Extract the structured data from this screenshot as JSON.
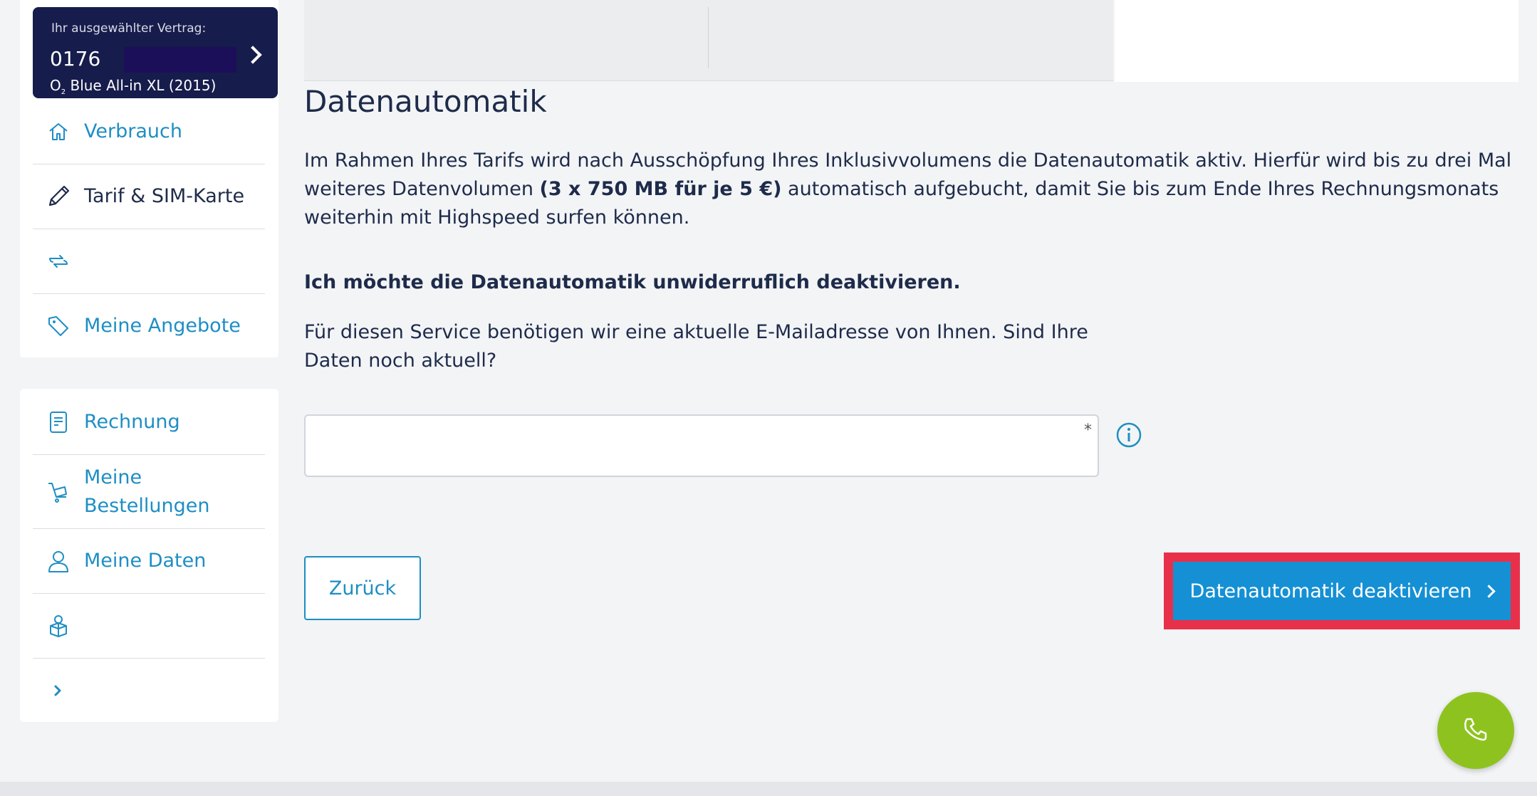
{
  "sidebar": {
    "contract": {
      "label": "Ihr ausgewählter Vertrag:",
      "number": "0176",
      "plan_prefix": "O",
      "plan_sub": "2",
      "plan_name": " Blue All-in XL (2015)"
    },
    "items": [
      {
        "label": "Verbrauch",
        "icon": "home-icon"
      },
      {
        "label": "Tarif & SIM-Karte",
        "icon": "pencil-icon"
      },
      {
        "label": "",
        "icon": "swap-arrows-icon"
      },
      {
        "label": "Meine Angebote",
        "icon": "tag-icon"
      }
    ],
    "items2": [
      {
        "label": "Rechnung",
        "icon": "invoice-icon"
      },
      {
        "label": "Meine Bestellungen",
        "icon": "cart-icon"
      },
      {
        "label": "Meine Daten",
        "icon": "user-icon"
      },
      {
        "label": "",
        "icon": "gift-icon"
      },
      {
        "label": "",
        "icon": "chevron-right-icon"
      }
    ]
  },
  "main": {
    "title": "Datenautomatik",
    "para_part1": "Im Rahmen Ihres Tarifs wird nach Ausschöpfung Ihres Inklusivvolumens die Datenautomatik aktiv. Hierfür wird bis zu drei Mal weiteres Datenvolumen ",
    "para_bold": "(3 x 750 MB für je 5 €)",
    "para_part2": " automatisch aufgebucht, damit Sie bis zum Ende Ihres Rechnungsmonats weiterhin mit Highspeed surfen können.",
    "deactivate_heading": "Ich möchte die Datenautomatik unwiderruflich deaktivieren.",
    "service_text": "Für diesen Service benötigen wir eine aktuelle E-Mailadresse von Ihnen. Sind Ihre Daten noch aktuell?",
    "email_value": "",
    "required_mark": "*",
    "back_label": "Zurück",
    "submit_label": "Datenautomatik deaktivieren"
  },
  "colors": {
    "accent": "#1e8ec4",
    "primary_button": "#1590d4",
    "highlight": "#e8304a",
    "contract_bg": "#161c4b",
    "fab": "#8ec31f"
  }
}
